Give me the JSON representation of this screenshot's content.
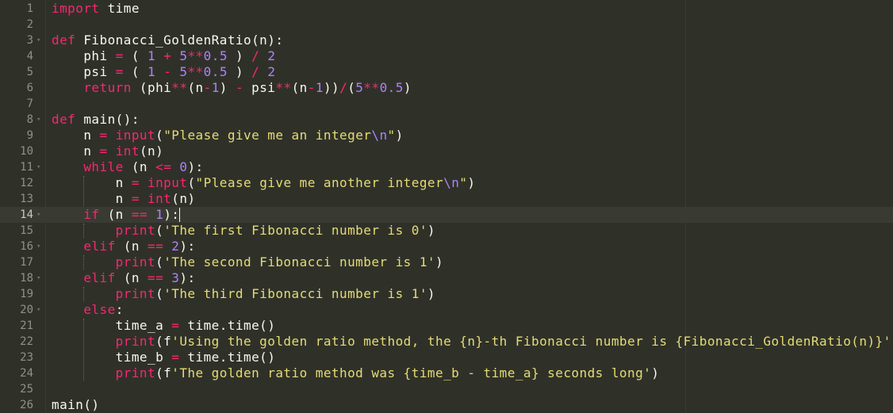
{
  "editor": {
    "theme_colors": {
      "background": "#2f3129",
      "keyword": "#f92672",
      "def_keyword": "#66d9ef",
      "number": "#ae81ff",
      "string": "#e6db74",
      "text": "#f8f8f2",
      "line_number": "#8f908a"
    },
    "active_line": 14,
    "lines": [
      {
        "num": "1",
        "fold": "",
        "tokens": [
          {
            "t": "import",
            "c": "kw"
          },
          {
            "t": " time",
            "c": "pl"
          }
        ]
      },
      {
        "num": "2",
        "fold": "",
        "tokens": []
      },
      {
        "num": "3",
        "fold": "▾",
        "tokens": [
          {
            "t": "def",
            "c": "kw"
          },
          {
            "t": " Fibonacci_GoldenRatio(n):",
            "c": "pl"
          }
        ]
      },
      {
        "num": "4",
        "fold": "",
        "tokens": [
          {
            "t": "    phi ",
            "c": "pl"
          },
          {
            "t": "=",
            "c": "op"
          },
          {
            "t": " ( ",
            "c": "pl"
          },
          {
            "t": "1",
            "c": "num"
          },
          {
            "t": " ",
            "c": "pl"
          },
          {
            "t": "+",
            "c": "op"
          },
          {
            "t": " ",
            "c": "pl"
          },
          {
            "t": "5",
            "c": "num"
          },
          {
            "t": "**",
            "c": "op"
          },
          {
            "t": "0.5",
            "c": "num"
          },
          {
            "t": " ) ",
            "c": "pl"
          },
          {
            "t": "/",
            "c": "op"
          },
          {
            "t": " ",
            "c": "pl"
          },
          {
            "t": "2",
            "c": "num"
          }
        ]
      },
      {
        "num": "5",
        "fold": "",
        "tokens": [
          {
            "t": "    psi ",
            "c": "pl"
          },
          {
            "t": "=",
            "c": "op"
          },
          {
            "t": " ( ",
            "c": "pl"
          },
          {
            "t": "1",
            "c": "num"
          },
          {
            "t": " ",
            "c": "pl"
          },
          {
            "t": "-",
            "c": "op"
          },
          {
            "t": " ",
            "c": "pl"
          },
          {
            "t": "5",
            "c": "num"
          },
          {
            "t": "**",
            "c": "op"
          },
          {
            "t": "0.5",
            "c": "num"
          },
          {
            "t": " ) ",
            "c": "pl"
          },
          {
            "t": "/",
            "c": "op"
          },
          {
            "t": " ",
            "c": "pl"
          },
          {
            "t": "2",
            "c": "num"
          }
        ]
      },
      {
        "num": "6",
        "fold": "",
        "tokens": [
          {
            "t": "    ",
            "c": "pl"
          },
          {
            "t": "return",
            "c": "kw"
          },
          {
            "t": " (phi",
            "c": "pl"
          },
          {
            "t": "**",
            "c": "op"
          },
          {
            "t": "(n",
            "c": "pl"
          },
          {
            "t": "-",
            "c": "op"
          },
          {
            "t": "1",
            "c": "num"
          },
          {
            "t": ") ",
            "c": "pl"
          },
          {
            "t": "-",
            "c": "op"
          },
          {
            "t": " psi",
            "c": "pl"
          },
          {
            "t": "**",
            "c": "op"
          },
          {
            "t": "(n",
            "c": "pl"
          },
          {
            "t": "-",
            "c": "op"
          },
          {
            "t": "1",
            "c": "num"
          },
          {
            "t": "))",
            "c": "pl"
          },
          {
            "t": "/",
            "c": "op"
          },
          {
            "t": "(",
            "c": "pl"
          },
          {
            "t": "5",
            "c": "num"
          },
          {
            "t": "**",
            "c": "op"
          },
          {
            "t": "0.5",
            "c": "num"
          },
          {
            "t": ")",
            "c": "pl"
          }
        ]
      },
      {
        "num": "7",
        "fold": "",
        "tokens": []
      },
      {
        "num": "8",
        "fold": "▾",
        "tokens": [
          {
            "t": "def",
            "c": "kw"
          },
          {
            "t": " main():",
            "c": "pl"
          }
        ]
      },
      {
        "num": "9",
        "fold": "",
        "tokens": [
          {
            "t": "    n ",
            "c": "pl"
          },
          {
            "t": "=",
            "c": "op"
          },
          {
            "t": " ",
            "c": "pl"
          },
          {
            "t": "input",
            "c": "op"
          },
          {
            "t": "(",
            "c": "pl"
          },
          {
            "t": "\"Please give me an integer",
            "c": "str"
          },
          {
            "t": "\\n",
            "c": "esc"
          },
          {
            "t": "\"",
            "c": "str"
          },
          {
            "t": ")",
            "c": "pl"
          }
        ]
      },
      {
        "num": "10",
        "fold": "",
        "tokens": [
          {
            "t": "    n ",
            "c": "pl"
          },
          {
            "t": "=",
            "c": "op"
          },
          {
            "t": " ",
            "c": "pl"
          },
          {
            "t": "int",
            "c": "op"
          },
          {
            "t": "(n)",
            "c": "pl"
          }
        ]
      },
      {
        "num": "11",
        "fold": "▾",
        "tokens": [
          {
            "t": "    ",
            "c": "pl"
          },
          {
            "t": "while",
            "c": "kw"
          },
          {
            "t": " (n ",
            "c": "pl"
          },
          {
            "t": "<=",
            "c": "op"
          },
          {
            "t": " ",
            "c": "pl"
          },
          {
            "t": "0",
            "c": "num"
          },
          {
            "t": "):",
            "c": "pl"
          }
        ]
      },
      {
        "num": "12",
        "fold": "",
        "tokens": [
          {
            "t": "        n ",
            "c": "pl"
          },
          {
            "t": "=",
            "c": "op"
          },
          {
            "t": " ",
            "c": "pl"
          },
          {
            "t": "input",
            "c": "op"
          },
          {
            "t": "(",
            "c": "pl"
          },
          {
            "t": "\"Please give me another integer",
            "c": "str"
          },
          {
            "t": "\\n",
            "c": "esc"
          },
          {
            "t": "\"",
            "c": "str"
          },
          {
            "t": ")",
            "c": "pl"
          }
        ]
      },
      {
        "num": "13",
        "fold": "",
        "tokens": [
          {
            "t": "        n ",
            "c": "pl"
          },
          {
            "t": "=",
            "c": "op"
          },
          {
            "t": " ",
            "c": "pl"
          },
          {
            "t": "int",
            "c": "op"
          },
          {
            "t": "(n)",
            "c": "pl"
          }
        ]
      },
      {
        "num": "14",
        "fold": "▾",
        "tokens": [
          {
            "t": "    ",
            "c": "pl"
          },
          {
            "t": "if",
            "c": "kw"
          },
          {
            "t": " (n ",
            "c": "pl"
          },
          {
            "t": "==",
            "c": "op"
          },
          {
            "t": " ",
            "c": "pl"
          },
          {
            "t": "1",
            "c": "num"
          },
          {
            "t": "):",
            "c": "pl"
          }
        ]
      },
      {
        "num": "15",
        "fold": "",
        "tokens": [
          {
            "t": "        ",
            "c": "pl"
          },
          {
            "t": "print",
            "c": "op"
          },
          {
            "t": "(",
            "c": "pl"
          },
          {
            "t": "'The first Fibonacci number is 0'",
            "c": "str"
          },
          {
            "t": ")",
            "c": "pl"
          }
        ]
      },
      {
        "num": "16",
        "fold": "▾",
        "tokens": [
          {
            "t": "    ",
            "c": "pl"
          },
          {
            "t": "elif",
            "c": "kw"
          },
          {
            "t": " (n ",
            "c": "pl"
          },
          {
            "t": "==",
            "c": "op"
          },
          {
            "t": " ",
            "c": "pl"
          },
          {
            "t": "2",
            "c": "num"
          },
          {
            "t": "):",
            "c": "pl"
          }
        ]
      },
      {
        "num": "17",
        "fold": "",
        "tokens": [
          {
            "t": "        ",
            "c": "pl"
          },
          {
            "t": "print",
            "c": "op"
          },
          {
            "t": "(",
            "c": "pl"
          },
          {
            "t": "'The second Fibonacci number is 1'",
            "c": "str"
          },
          {
            "t": ")",
            "c": "pl"
          }
        ]
      },
      {
        "num": "18",
        "fold": "▾",
        "tokens": [
          {
            "t": "    ",
            "c": "pl"
          },
          {
            "t": "elif",
            "c": "kw"
          },
          {
            "t": " (n ",
            "c": "pl"
          },
          {
            "t": "==",
            "c": "op"
          },
          {
            "t": " ",
            "c": "pl"
          },
          {
            "t": "3",
            "c": "num"
          },
          {
            "t": "):",
            "c": "pl"
          }
        ]
      },
      {
        "num": "19",
        "fold": "",
        "tokens": [
          {
            "t": "        ",
            "c": "pl"
          },
          {
            "t": "print",
            "c": "op"
          },
          {
            "t": "(",
            "c": "pl"
          },
          {
            "t": "'The third Fibonacci number is 1'",
            "c": "str"
          },
          {
            "t": ")",
            "c": "pl"
          }
        ]
      },
      {
        "num": "20",
        "fold": "▾",
        "tokens": [
          {
            "t": "    ",
            "c": "pl"
          },
          {
            "t": "else",
            "c": "kw"
          },
          {
            "t": ":",
            "c": "pl"
          }
        ]
      },
      {
        "num": "21",
        "fold": "",
        "tokens": [
          {
            "t": "        time_a ",
            "c": "pl"
          },
          {
            "t": "=",
            "c": "op"
          },
          {
            "t": " time.time()",
            "c": "pl"
          }
        ]
      },
      {
        "num": "22",
        "fold": "",
        "tokens": [
          {
            "t": "        ",
            "c": "pl"
          },
          {
            "t": "print",
            "c": "op"
          },
          {
            "t": "(f",
            "c": "pl"
          },
          {
            "t": "'Using the golden ratio method, the {n}-th Fibonacci number is {Fibonacci_GoldenRatio(n)}'",
            "c": "str"
          },
          {
            "t": ")",
            "c": "pl"
          }
        ]
      },
      {
        "num": "23",
        "fold": "",
        "tokens": [
          {
            "t": "        time_b ",
            "c": "pl"
          },
          {
            "t": "=",
            "c": "op"
          },
          {
            "t": " time.time()",
            "c": "pl"
          }
        ]
      },
      {
        "num": "24",
        "fold": "",
        "tokens": [
          {
            "t": "        ",
            "c": "pl"
          },
          {
            "t": "print",
            "c": "op"
          },
          {
            "t": "(f",
            "c": "pl"
          },
          {
            "t": "'The golden ratio method was {time_b - time_a} seconds long'",
            "c": "str"
          },
          {
            "t": ")",
            "c": "pl"
          }
        ]
      },
      {
        "num": "25",
        "fold": "",
        "tokens": []
      },
      {
        "num": "26",
        "fold": "",
        "tokens": [
          {
            "t": "main()",
            "c": "pl"
          }
        ]
      }
    ]
  }
}
